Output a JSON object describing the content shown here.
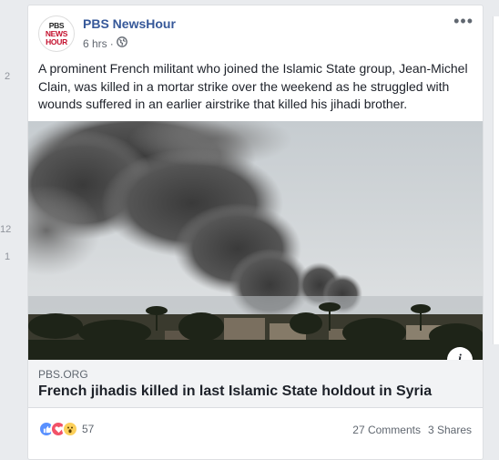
{
  "sidebar_numbers": [
    "2",
    "12",
    "1"
  ],
  "post": {
    "page_name": "PBS NewsHour",
    "logo_text": [
      "PBS",
      "NEWS",
      "HOUR"
    ],
    "time": "6 hrs",
    "separator": "·",
    "text": "A prominent French militant who joined the Islamic State group, Jean-Michel Clain, was killed in a mortar strike over the weekend as he struggled with wounds suffered in an earlier airstrike that killed his jihadi brother.",
    "more_label": "•••",
    "info_label": "i"
  },
  "link": {
    "domain": "PBS.ORG",
    "title": "French jihadis killed in last Islamic State holdout in Syria"
  },
  "engagement": {
    "reactions": [
      "like-icon",
      "love-icon",
      "wow-icon"
    ],
    "reaction_count": "57",
    "comments": "27 Comments",
    "shares": "3 Shares"
  },
  "colors": {
    "page_name": "#365899",
    "like": "#5890ff",
    "love": "#f25268",
    "wow": "#fcd05b",
    "background": "#e9ebee"
  }
}
